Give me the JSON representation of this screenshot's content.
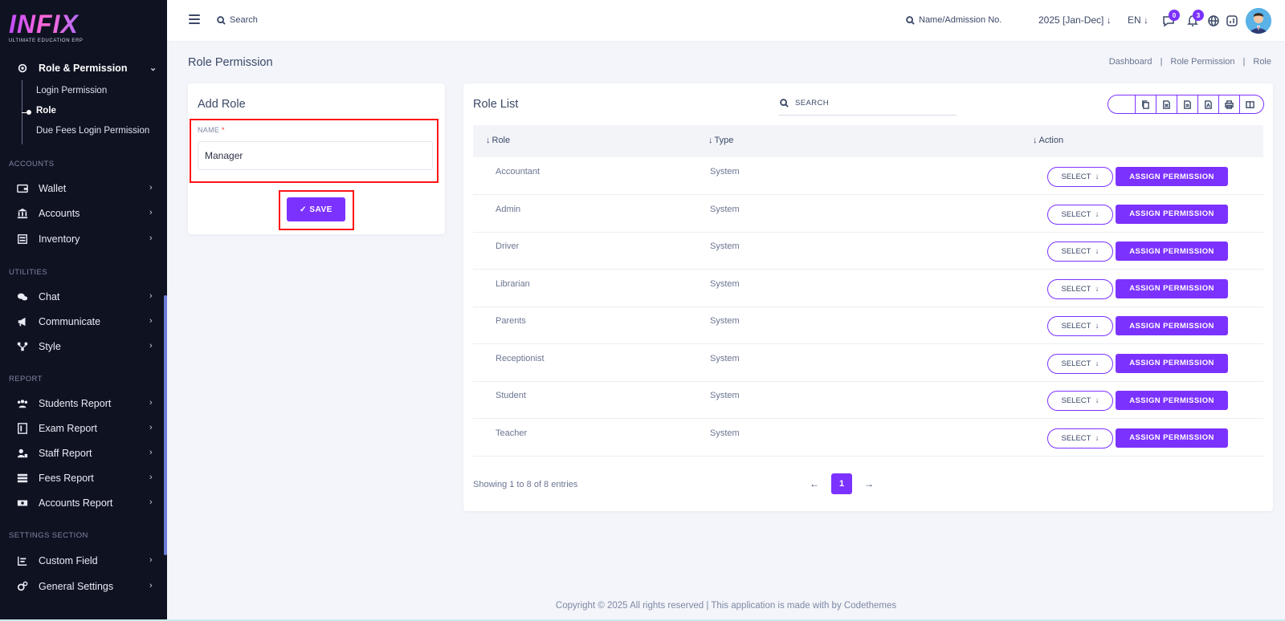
{
  "app": {
    "logo_text": "INFIX",
    "logo_subtitle": "ULTIMATE EDUCATION ERP"
  },
  "sidebar": {
    "open_group": {
      "label": "Role & Permission",
      "sub_items": [
        "Login Permission",
        "Role",
        "Due Fees Login Permission"
      ],
      "current": "Role"
    },
    "sections": [
      {
        "label": "ACCOUNTS",
        "items": [
          "Wallet",
          "Accounts",
          "Inventory"
        ]
      },
      {
        "label": "UTILITIES",
        "items": [
          "Chat",
          "Communicate",
          "Style"
        ]
      },
      {
        "label": "REPORT",
        "items": [
          "Students Report",
          "Exam Report",
          "Staff Report",
          "Fees Report",
          "Accounts Report"
        ]
      },
      {
        "label": "SETTINGS SECTION",
        "items": [
          "Custom Field",
          "General Settings"
        ]
      }
    ]
  },
  "header": {
    "search_label": "Search",
    "admission_search_label": "Name/Admission No.",
    "academic_year": "2025 [Jan-Dec]",
    "language": "EN",
    "chat_badge": "0",
    "notification_badge": "3"
  },
  "page": {
    "title": "Role Permission",
    "breadcrumb": [
      "Dashboard",
      "Role Permission",
      "Role"
    ]
  },
  "add_role": {
    "title": "Add Role",
    "name_label": "NAME",
    "required_mark": "*",
    "name_value": "Manager",
    "save_label": "SAVE"
  },
  "role_list": {
    "title": "Role List",
    "search_placeholder": "SEARCH",
    "columns": [
      "Role",
      "Type",
      "Action"
    ],
    "rows": [
      {
        "role": "Accountant",
        "type": "System"
      },
      {
        "role": "Admin",
        "type": "System"
      },
      {
        "role": "Driver",
        "type": "System"
      },
      {
        "role": "Librarian",
        "type": "System"
      },
      {
        "role": "Parents",
        "type": "System"
      },
      {
        "role": "Receptionist",
        "type": "System"
      },
      {
        "role": "Student",
        "type": "System"
      },
      {
        "role": "Teacher",
        "type": "System"
      }
    ],
    "select_label": "SELECT",
    "assign_label": "ASSIGN PERMISSION",
    "showing": "Showing 1 to 8 of 8 entries",
    "current_page": "1"
  },
  "footer": {
    "text": "Copyright © 2025 All rights reserved | This application is made with by Codethemes"
  },
  "colors": {
    "accent": "#7c32ff",
    "sidebar_bg": "#0f1221",
    "highlight": "#ff1414"
  }
}
